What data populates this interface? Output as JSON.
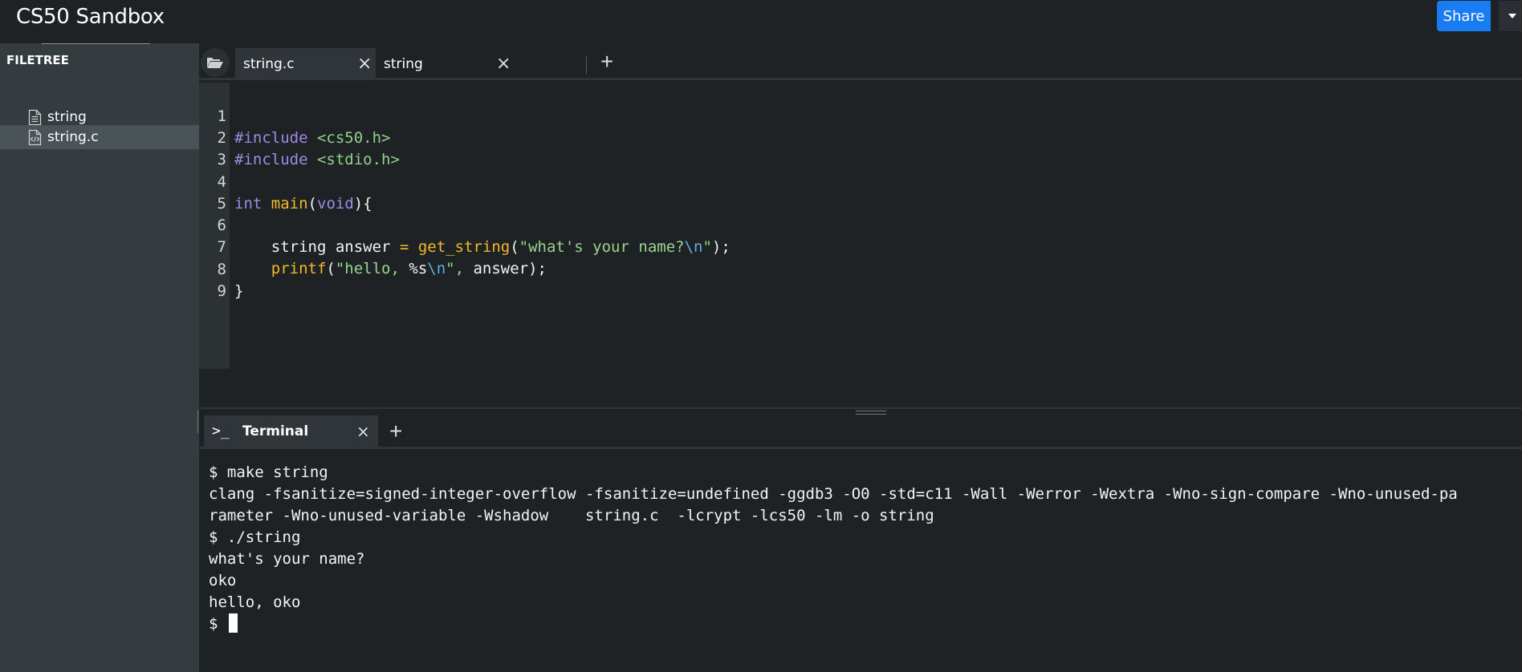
{
  "app": {
    "title": "CS50 Sandbox",
    "share_label": "Share"
  },
  "sidebar": {
    "title": "FILETREE",
    "files": [
      {
        "name": "string",
        "icon": "text-file-icon"
      },
      {
        "name": "string.c",
        "icon": "code-file-icon",
        "selected": true
      }
    ]
  },
  "editor": {
    "tabs": [
      {
        "label": "string.c",
        "active": true
      },
      {
        "label": "string",
        "active": false
      }
    ],
    "close_glyph": "×",
    "add_glyph": "+",
    "line_numbers": [
      "1",
      "2",
      "3",
      "4",
      "5",
      "6",
      "7",
      "8",
      "9"
    ],
    "code": {
      "l1_directive": "#include",
      "l1_header": " <cs50.h>",
      "l2_directive": "#include",
      "l2_header": " <stdio.h>",
      "l4_type": "int",
      "l4_func": "main",
      "l4_paren_open": "(",
      "l4_void": "void",
      "l4_rest": "){",
      "l6_decl": "string answer ",
      "l6_eq": "=",
      "l6_space": " ",
      "l6_func": "get_string",
      "l6_paren": "(",
      "l6_str": "\"what's your name?",
      "l6_esc": "\\n",
      "l6_strend": "\"",
      "l6_end": ");",
      "l7_func": "printf",
      "l7_paren": "(",
      "l7_str1": "\"hello, ",
      "l7_fmt": "%s",
      "l7_esc": "\\n",
      "l7_str2": "\", ",
      "l7_end": "answer);",
      "l8": "}"
    }
  },
  "terminal": {
    "tab_label": "Terminal",
    "prompt_icon": ">_",
    "close_glyph": "×",
    "add_glyph": "+",
    "lines": [
      "$ make string",
      "clang -fsanitize=signed-integer-overflow -fsanitize=undefined -ggdb3 -O0 -std=c11 -Wall -Werror -Wextra -Wno-sign-compare -Wno-unused-pa",
      "rameter -Wno-unused-variable -Wshadow    string.c  -lcrypt -lcs50 -lm -o string",
      "$ ./string",
      "what's your name?",
      "oko",
      "hello, oko"
    ],
    "current_prompt": "$ "
  },
  "colors": {
    "accent": "#1a7cf5",
    "background": "#1f2224",
    "sidebar": "#353c40",
    "keyword": "#9f8be6",
    "function": "#f2b92c",
    "string": "#99d48f",
    "escape": "#5dade2"
  }
}
